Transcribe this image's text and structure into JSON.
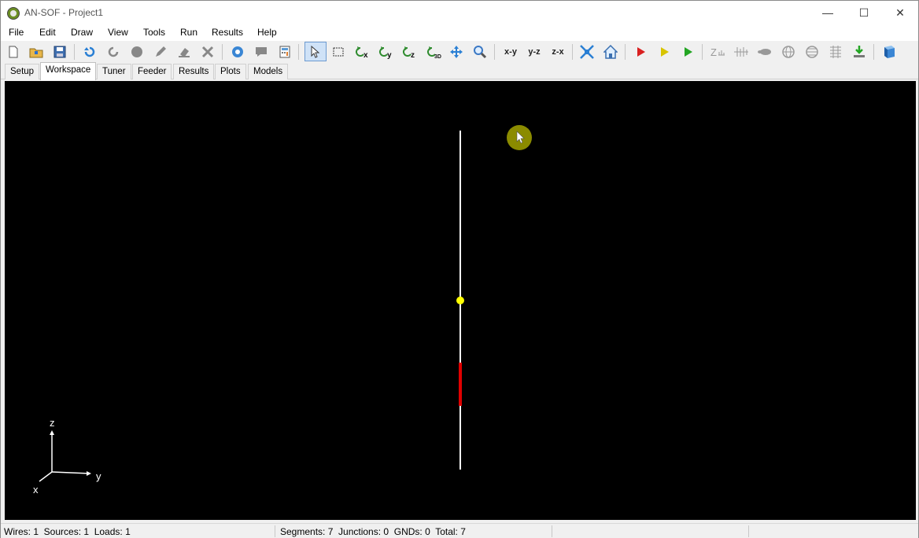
{
  "window": {
    "title": "AN-SOF - Project1"
  },
  "window_controls": {
    "minimize": "—",
    "maximize": "☐",
    "close": "✕"
  },
  "menu": [
    "File",
    "Edit",
    "Draw",
    "View",
    "Tools",
    "Run",
    "Results",
    "Help"
  ],
  "toolbar": {
    "view_xy": "x-y",
    "view_yz": "y-z",
    "view_zx": "z-x",
    "icons": [
      "new-file-icon",
      "open-folder-icon",
      "save-icon",
      "undo-icon",
      "redo-icon",
      "stop-icon",
      "pencil-icon",
      "eraser-icon",
      "delete-icon",
      "settings-icon",
      "comment-icon",
      "calculator-icon",
      "select-pointer-icon",
      "rectangle-select-icon",
      "rotate-x-icon",
      "rotate-y-icon",
      "rotate-z-icon",
      "rotate-3d-icon",
      "pan-icon",
      "zoom-icon",
      "fit-view-icon",
      "home-icon",
      "run-red-icon",
      "run-yellow-icon",
      "run-green-icon",
      "impedance-icon",
      "current-icon",
      "pattern-icon",
      "globe-icon",
      "globe-3d-icon",
      "table-icon",
      "export-icon",
      "help-book-icon"
    ]
  },
  "tabs": [
    "Setup",
    "Workspace",
    "Tuner",
    "Feeder",
    "Results",
    "Plots",
    "Models"
  ],
  "active_tab": "Workspace",
  "axes": {
    "z": "z",
    "y": "y",
    "x": "x"
  },
  "status": {
    "left": "Wires: 1  Sources: 1  Loads: 1",
    "middle": "Segments: 7  Junctions: 0  GNDs: 0  Total: 7"
  },
  "colors": {
    "workspace_bg": "#000000",
    "wire": "#ffffff",
    "source": "#ffff00",
    "load": "#e00000",
    "cursor_highlight": "#8b8b00"
  }
}
